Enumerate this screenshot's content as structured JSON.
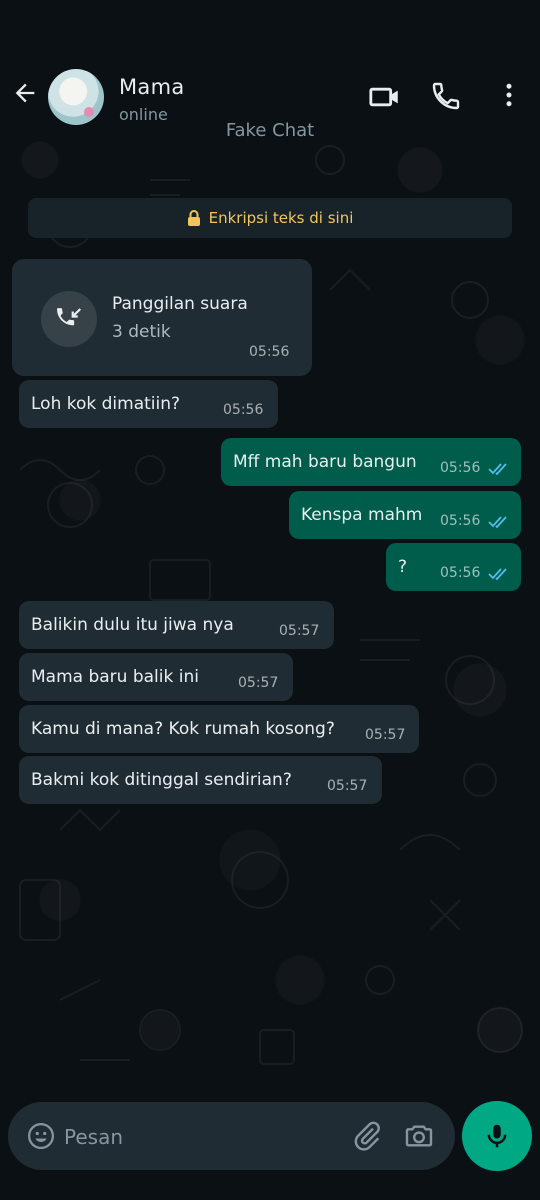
{
  "header": {
    "contact_name": "Mama",
    "contact_status": "online",
    "watermark": "Fake Chat",
    "icons": {
      "back": "arrow-left-icon",
      "video": "video-camera-icon",
      "call": "phone-icon",
      "menu": "more-vert-icon"
    }
  },
  "encryption_banner": {
    "text": "Enkripsi teks di sini",
    "icon": "lock-icon"
  },
  "call_log": {
    "title": "Panggilan suara",
    "duration": "3 detik",
    "time": "05:56",
    "icon": "missed-call-arrow-icon"
  },
  "messages": [
    {
      "dir": "in",
      "text": "Loh kok dimatiin?",
      "time": "05:56"
    },
    {
      "dir": "out",
      "text": "Mff mah baru bangun",
      "time": "05:56",
      "status": "read"
    },
    {
      "dir": "out",
      "text": "Kenspa mahm",
      "time": "05:56",
      "status": "read"
    },
    {
      "dir": "out",
      "text": "?",
      "time": "05:56",
      "status": "read"
    },
    {
      "dir": "in",
      "text": "Balikin dulu itu jiwa nya",
      "time": "05:57"
    },
    {
      "dir": "in",
      "text": "Mama baru balik ini",
      "time": "05:57"
    },
    {
      "dir": "in",
      "text": "Kamu di mana? Kok rumah kosong?",
      "time": "05:57"
    },
    {
      "dir": "in",
      "text": "Bakmi kok ditinggal sendirian?",
      "time": "05:57"
    }
  ],
  "composer": {
    "placeholder": "Pesan",
    "icons": {
      "emoji": "emoji-icon",
      "attach": "paperclip-icon",
      "camera": "camera-icon",
      "mic": "mic-icon"
    }
  },
  "colors": {
    "background": "#0b1014",
    "incoming_bubble": "#202c33",
    "outgoing_bubble": "#005c4b",
    "accent": "#00a884",
    "read_tick": "#53bdeb",
    "banner_text": "#f2c55c"
  }
}
